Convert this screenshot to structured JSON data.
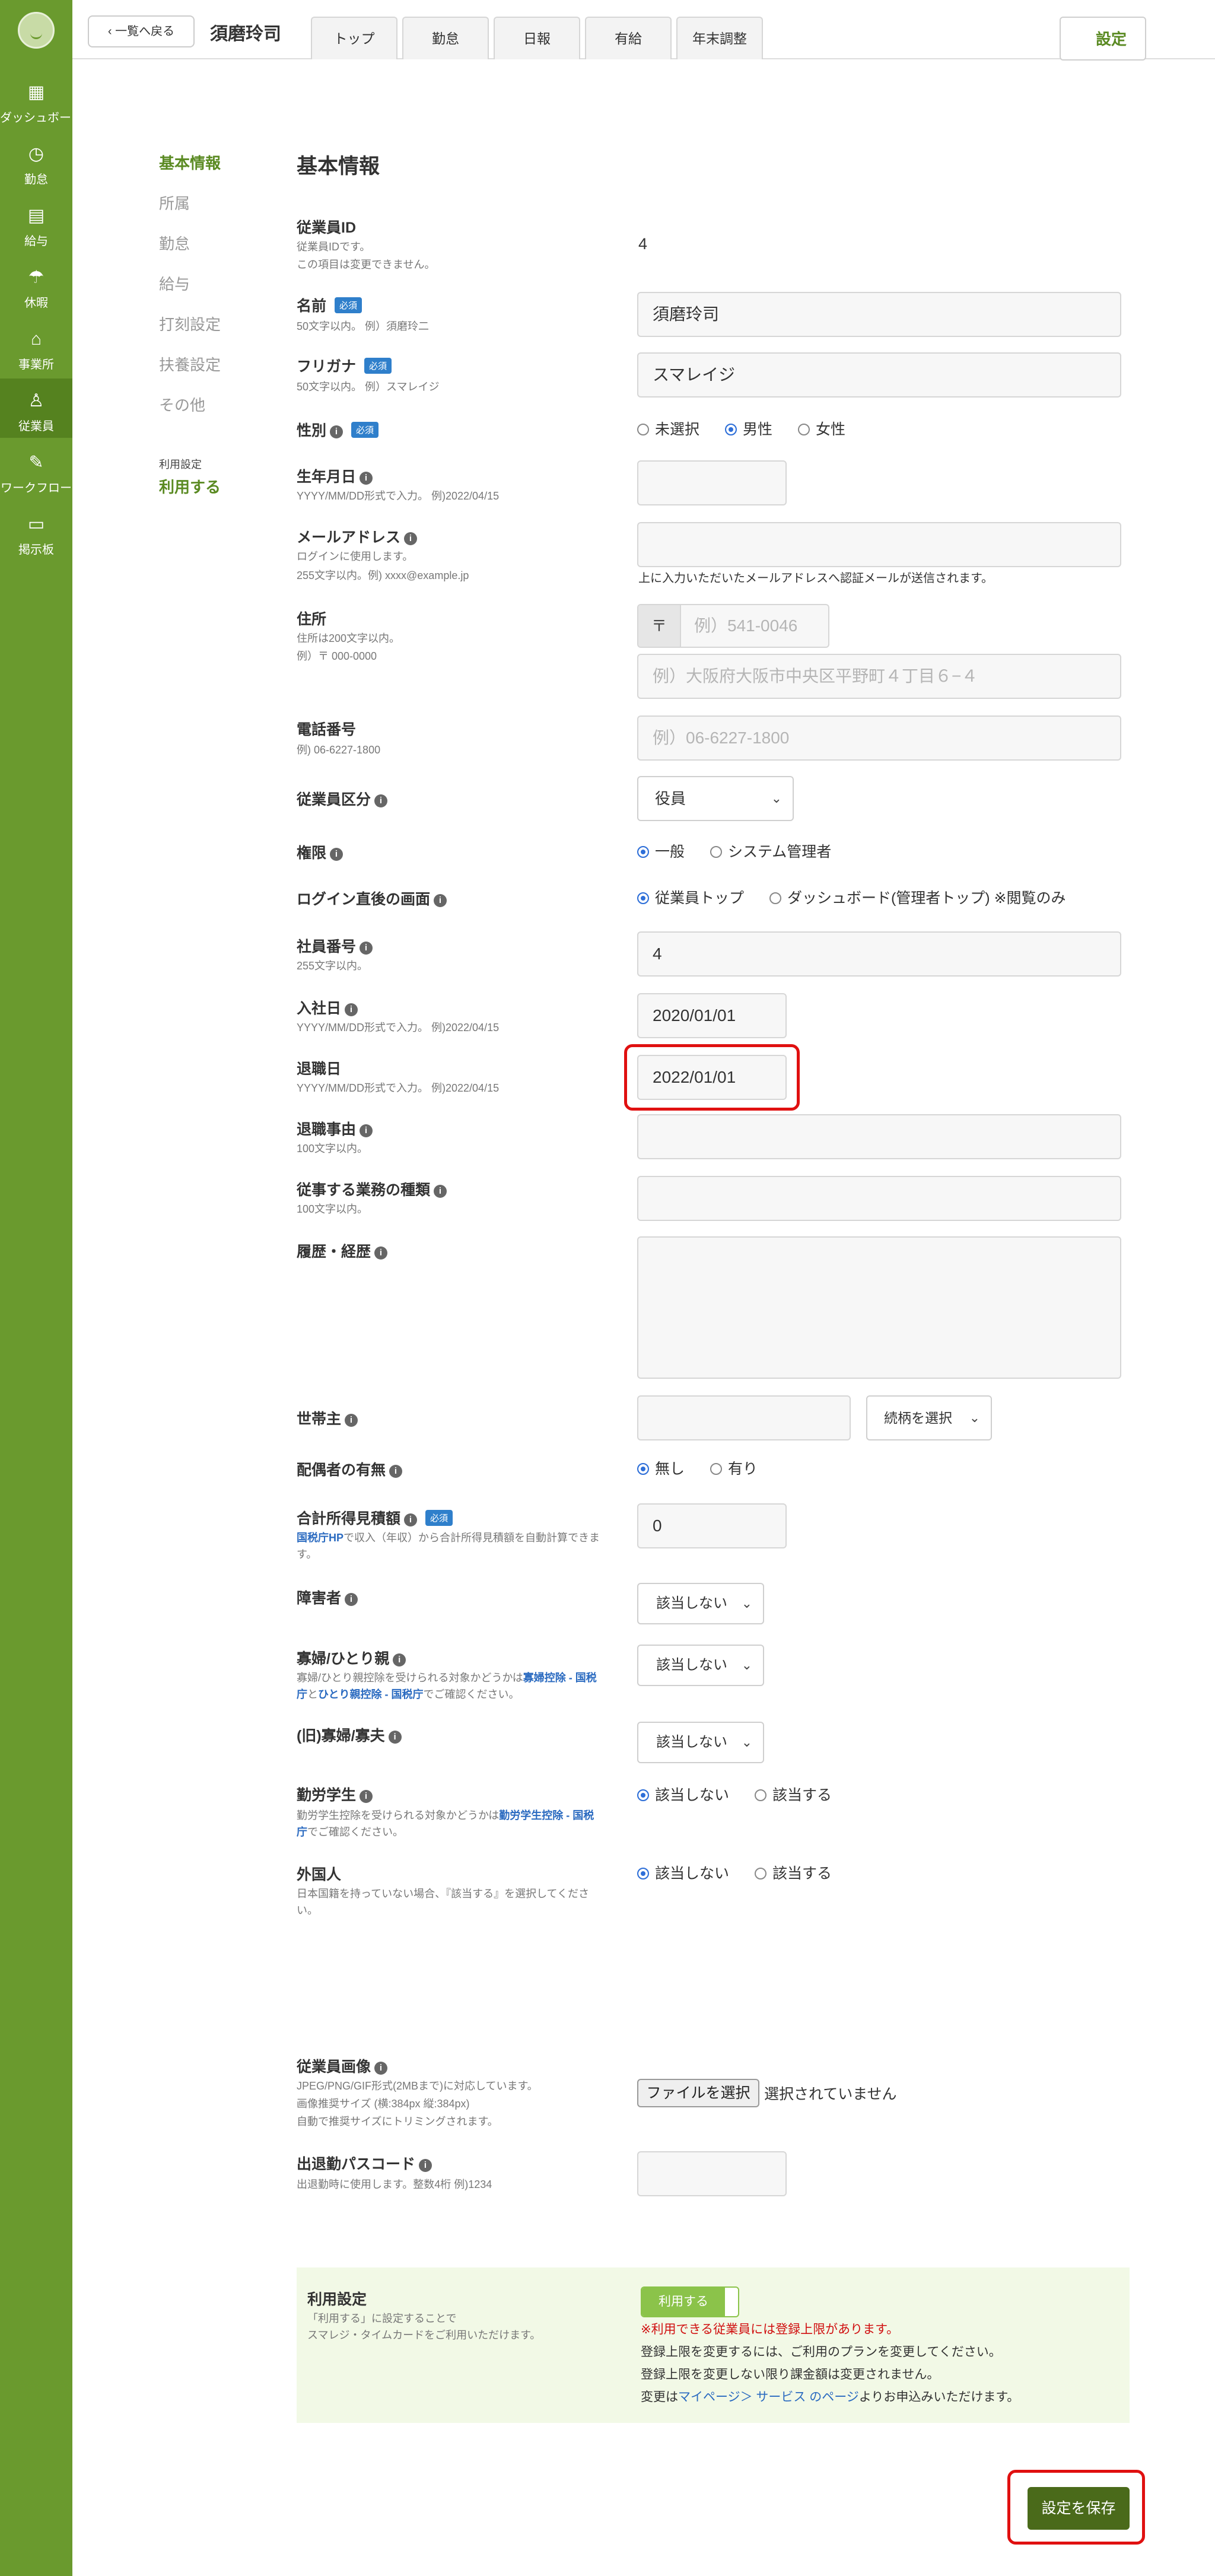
{
  "sidebar": {
    "items": [
      {
        "label": "ダッシュボード",
        "icon": "dashboard-icon"
      },
      {
        "label": "勤怠",
        "icon": "clock-icon"
      },
      {
        "label": "給与",
        "icon": "calculator-icon"
      },
      {
        "label": "休暇",
        "icon": "umbrella-icon"
      },
      {
        "label": "事業所",
        "icon": "home-icon"
      },
      {
        "label": "従業員",
        "icon": "person-icon"
      },
      {
        "label": "ワークフロー",
        "icon": "workflow-icon"
      },
      {
        "label": "掲示板",
        "icon": "chat-icon"
      }
    ]
  },
  "header": {
    "back_label": "一覧へ戻る",
    "employee_name": "須磨玲司",
    "tabs": [
      "トップ",
      "勤怠",
      "日報",
      "有給",
      "年末調整"
    ],
    "settings_tab": "設定"
  },
  "leftnav": {
    "items": [
      "基本情報",
      "所属",
      "勤怠",
      "給与",
      "打刻設定",
      "扶養設定",
      "その他"
    ],
    "usage_label": "利用設定",
    "usage_value": "利用する"
  },
  "form": {
    "title": "基本情報",
    "employee_id": {
      "label": "従業員ID",
      "hint1": "従業員IDです。",
      "hint2": "この項目は変更できません。",
      "value": "4"
    },
    "name": {
      "label": "名前",
      "required": "必須",
      "hint": "50文字以内。 例）須磨玲二",
      "value": "須磨玲司"
    },
    "kana": {
      "label": "フリガナ",
      "required": "必須",
      "hint": "50文字以内。 例）スマレイジ",
      "value": "スマレイジ"
    },
    "gender": {
      "label": "性別",
      "required": "必須",
      "options": [
        "未選択",
        "男性",
        "女性"
      ]
    },
    "birthday": {
      "label": "生年月日",
      "hint": "YYYY/MM/DD形式で入力。 例)2022/04/15"
    },
    "email": {
      "label": "メールアドレス",
      "hint1": "ログインに使用します。",
      "hint2": "255文字以内。例) xxxx@example.jp",
      "note": "上に入力いただいたメールアドレスへ認証メールが送信されます。"
    },
    "address": {
      "label": "住所",
      "hint1": "住所は200文字以内。",
      "hint2": "例）〒 000-0000",
      "zip_mark": "〒",
      "zip_placeholder": "例）541-0046",
      "addr_placeholder": "例）大阪府大阪市中央区平野町４丁目６−４"
    },
    "phone": {
      "label": "電話番号",
      "hint": "例) 06-6227-1800",
      "placeholder": "例）06-6227-1800"
    },
    "emp_type": {
      "label": "従業員区分",
      "value": "役員"
    },
    "permission": {
      "label": "権限",
      "options": [
        "一般",
        "システム管理者"
      ]
    },
    "login_screen": {
      "label": "ログイン直後の画面",
      "options": [
        "従業員トップ",
        "ダッシュボード(管理者トップ) ※閲覧のみ"
      ]
    },
    "emp_number": {
      "label": "社員番号",
      "hint": "255文字以内。",
      "value": "4"
    },
    "hire_date": {
      "label": "入社日",
      "hint": "YYYY/MM/DD形式で入力。 例)2022/04/15",
      "value": "2020/01/01"
    },
    "retire_date": {
      "label": "退職日",
      "hint": "YYYY/MM/DD形式で入力。 例)2022/04/15",
      "value": "2022/01/01"
    },
    "retire_reason": {
      "label": "退職事由",
      "hint": "100文字以内。"
    },
    "job_type": {
      "label": "従事する業務の種類",
      "hint": "100文字以内。"
    },
    "history": {
      "label": "履歴・経歴"
    },
    "householder": {
      "label": "世帯主",
      "select": "続柄を選択"
    },
    "spouse": {
      "label": "配偶者の有無",
      "options": [
        "無し",
        "有り"
      ]
    },
    "income": {
      "label": "合計所得見積額",
      "required": "必須",
      "hint_link": "国税庁HP",
      "hint_rest": "で収入（年収）から合計所得見積額を自動計算できま",
      "hint2": "す。",
      "value": "0"
    },
    "disability": {
      "label": "障害者",
      "value": "該当しない"
    },
    "widow": {
      "label": "寡婦/ひとり親",
      "hint1": "寡婦/ひとり親控除を受けられる対象かどうかは",
      "hint1_link": "寡婦控除 - 国税",
      "hint2_link1": "庁",
      "hint2_mid": "と",
      "hint2_link2": "ひとり親控除 - 国税庁",
      "hint2_rest": "でご確認ください。",
      "value": "該当しない"
    },
    "old_widow": {
      "label": "(旧)寡婦/寡夫",
      "value": "該当しない"
    },
    "student": {
      "label": "勤労学生",
      "hint1": "勤労学生控除を受けられる対象かどうかは",
      "hint1_link": "勤労学生控除 - 国税",
      "hint2_link": "庁",
      "hint2_rest": "でご確認ください。",
      "options": [
        "該当しない",
        "該当する"
      ]
    },
    "foreigner": {
      "label": "外国人",
      "hint1": "日本国籍を持っていない場合、『該当する』を選択してくださ",
      "hint2": "い。",
      "options": [
        "該当しない",
        "該当する"
      ]
    },
    "photo": {
      "label": "従業員画像",
      "hint1": "JPEG/PNG/GIF形式(2MBまで)に対応しています。",
      "hint2": "画像推奨サイズ (横:384px 縦:384px)",
      "hint3": "自動で推奨サイズにトリミングされます。",
      "button": "ファイルを選択",
      "status": "選択されていません"
    },
    "passcode": {
      "label": "出退勤パスコード",
      "hint": "出退勤時に使用します。整数4桁 例)1234"
    }
  },
  "usage": {
    "title": "利用設定",
    "desc1": "「利用する」に設定することで",
    "desc2": "スマレジ・タイムカードをご利用いただけます。",
    "toggle": "利用する",
    "warn": "※利用できる従業員には登録上限があります。",
    "line1": "登録上限を変更するには、ご利用のプランを変更してください。",
    "line2": "登録上限を変更しない限り課金額は変更されません。",
    "line3_pre": "変更は",
    "line3_link": "マイページ＞ サービス のページ",
    "line3_post": "よりお申込みいただけます。"
  },
  "save_label": "設定を保存",
  "colors": {
    "sidebar": "#6a9a2e",
    "accent": "#5a8a22",
    "required_badge": "#2f7fcb",
    "highlight": "#e01010",
    "save_button": "#4a6a1a"
  }
}
